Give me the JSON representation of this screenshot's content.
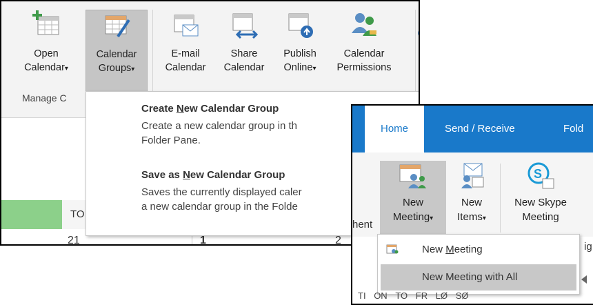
{
  "left": {
    "ribbon": {
      "open_calendar": {
        "line1": "Open",
        "line2": "Calendar",
        "arrow": "▾"
      },
      "calendar_groups": {
        "line1": "Calendar",
        "line2": "Groups",
        "arrow": "▾"
      },
      "email_calendar": {
        "line1": "E-mail",
        "line2": "Calendar"
      },
      "share_calendar": {
        "line1": "Share",
        "line2": "Calendar"
      },
      "publish_online": {
        "line1": "Publish",
        "line2": "Online",
        "arrow": "▾"
      },
      "calendar_permissions": {
        "line1": "Calendar",
        "line2": "Permissions"
      },
      "group_label": "Manage C"
    },
    "dropdown": {
      "item1_title_pre": "Create ",
      "item1_title_u": "N",
      "item1_title_post": "ew Calendar Group",
      "item1_desc1": "Create a new calendar group in th",
      "item1_desc2": "Folder Pane.",
      "item2_title_pre": "Save as ",
      "item2_title_u": "N",
      "item2_title_post": "ew Calendar Group",
      "item2_desc1": "Saves the currently displayed caler",
      "item2_desc2": "a new calendar group in the Folde"
    },
    "calendar": {
      "col_header": "TO",
      "day1": "21",
      "day2": "1",
      "day3": "2"
    }
  },
  "right": {
    "tabs": {
      "home": "Home",
      "send_receive": "Send / Receive",
      "folder": "Fold"
    },
    "ribbon": {
      "partial": "hent",
      "new_meeting": {
        "line1": "New",
        "line2": "Meeting",
        "arrow": "▾"
      },
      "new_items": {
        "line1": "New",
        "line2": "Items",
        "arrow": "▾"
      },
      "new_skype": {
        "line1": "New Skype",
        "line2": "Meeting"
      },
      "edge": "ig"
    },
    "dropdown": {
      "item1_pre": "New ",
      "item1_u": "M",
      "item1_post": "eeting",
      "item2": "New Meeting with All"
    },
    "weekdays": [
      "TI",
      "ON",
      "TO",
      "FR",
      "LØ",
      "SØ"
    ]
  }
}
